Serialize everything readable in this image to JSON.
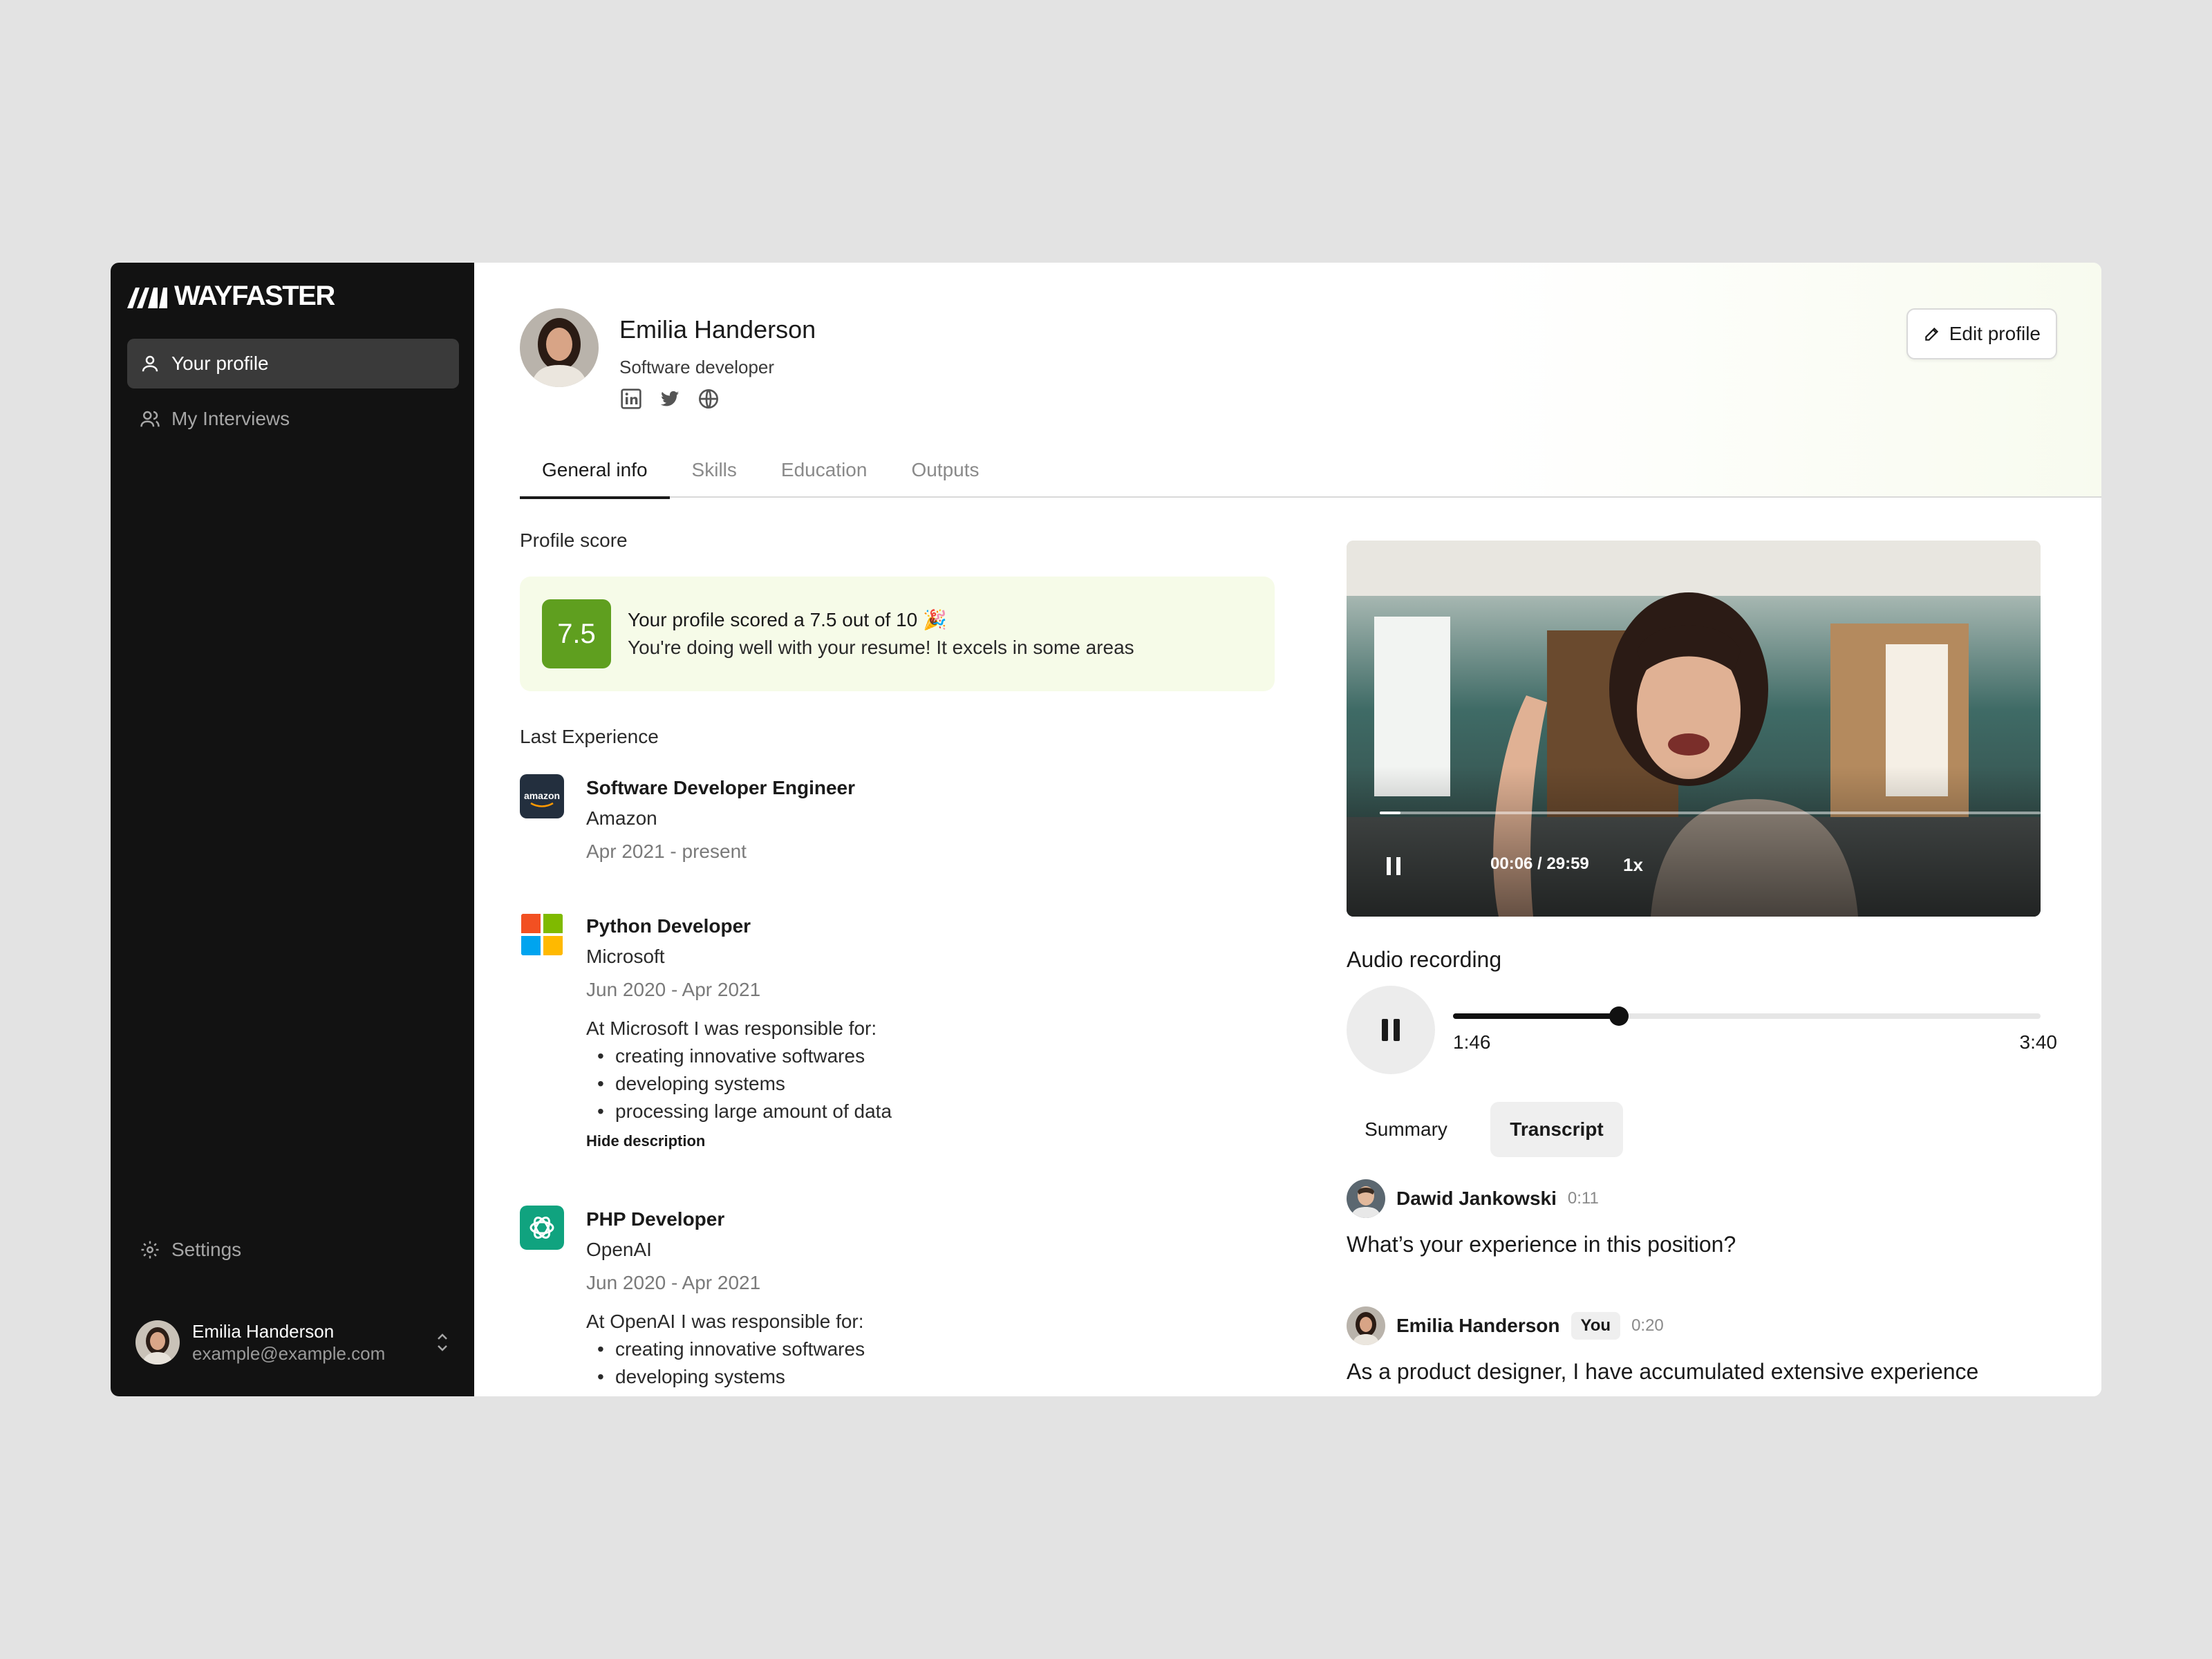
{
  "sidebar": {
    "brand": "WAYFASTER",
    "nav": [
      {
        "label": "Your profile",
        "icon": "user-icon",
        "active": true
      },
      {
        "label": "My Interviews",
        "icon": "users-icon",
        "active": false
      }
    ],
    "settings_label": "Settings",
    "user": {
      "name": "Emilia Handerson",
      "email": "example@example.com"
    }
  },
  "profile": {
    "name": "Emilia Handerson",
    "role": "Software developer",
    "socials": [
      "linkedin-icon",
      "twitter-icon",
      "globe-icon"
    ],
    "edit_label": "Edit profile"
  },
  "tabs": [
    "General info",
    "Skills",
    "Education",
    "Outputs"
  ],
  "score": {
    "section_label": "Profile score",
    "value": "7.5",
    "line1": "Your profile scored a 7.5 out of 10 🎉",
    "line2": "You're doing well with your resume! It excels in some areas"
  },
  "experience": {
    "section_label": "Last Experience",
    "items": [
      {
        "title": "Software Developer Engineer",
        "company": "Amazon",
        "dates": "Apr 2021 - present"
      },
      {
        "title": "Python Developer",
        "company": "Microsoft",
        "dates": "Jun 2020 - Apr 2021",
        "desc": "At Microsoft I was responsible for:",
        "bullets": [
          "creating innovative softwares",
          "developing systems",
          "processing large amount of data"
        ],
        "toggle": "Hide description"
      },
      {
        "title": "PHP Developer",
        "company": "OpenAI",
        "dates": "Jun 2020 - Apr 2021",
        "desc": "At OpenAI I was responsible for:",
        "bullets": [
          "creating innovative softwares",
          "developing systems"
        ]
      }
    ]
  },
  "video": {
    "time": "00:06 / 29:59",
    "speed": "1x",
    "progress": 0.005
  },
  "audio": {
    "label": "Audio recording",
    "current": "1:46",
    "total": "3:40",
    "progress": 0.282
  },
  "segments": {
    "summary": "Summary",
    "transcript": "Transcript"
  },
  "transcript": [
    {
      "name": "Dawid Jankowski",
      "time": "0:11",
      "text": "What’s your experience in this position?"
    },
    {
      "name": "Emilia Handerson",
      "badge": "You",
      "time": "0:20",
      "text": "As a product designer, I have accumulated extensive experience"
    }
  ]
}
